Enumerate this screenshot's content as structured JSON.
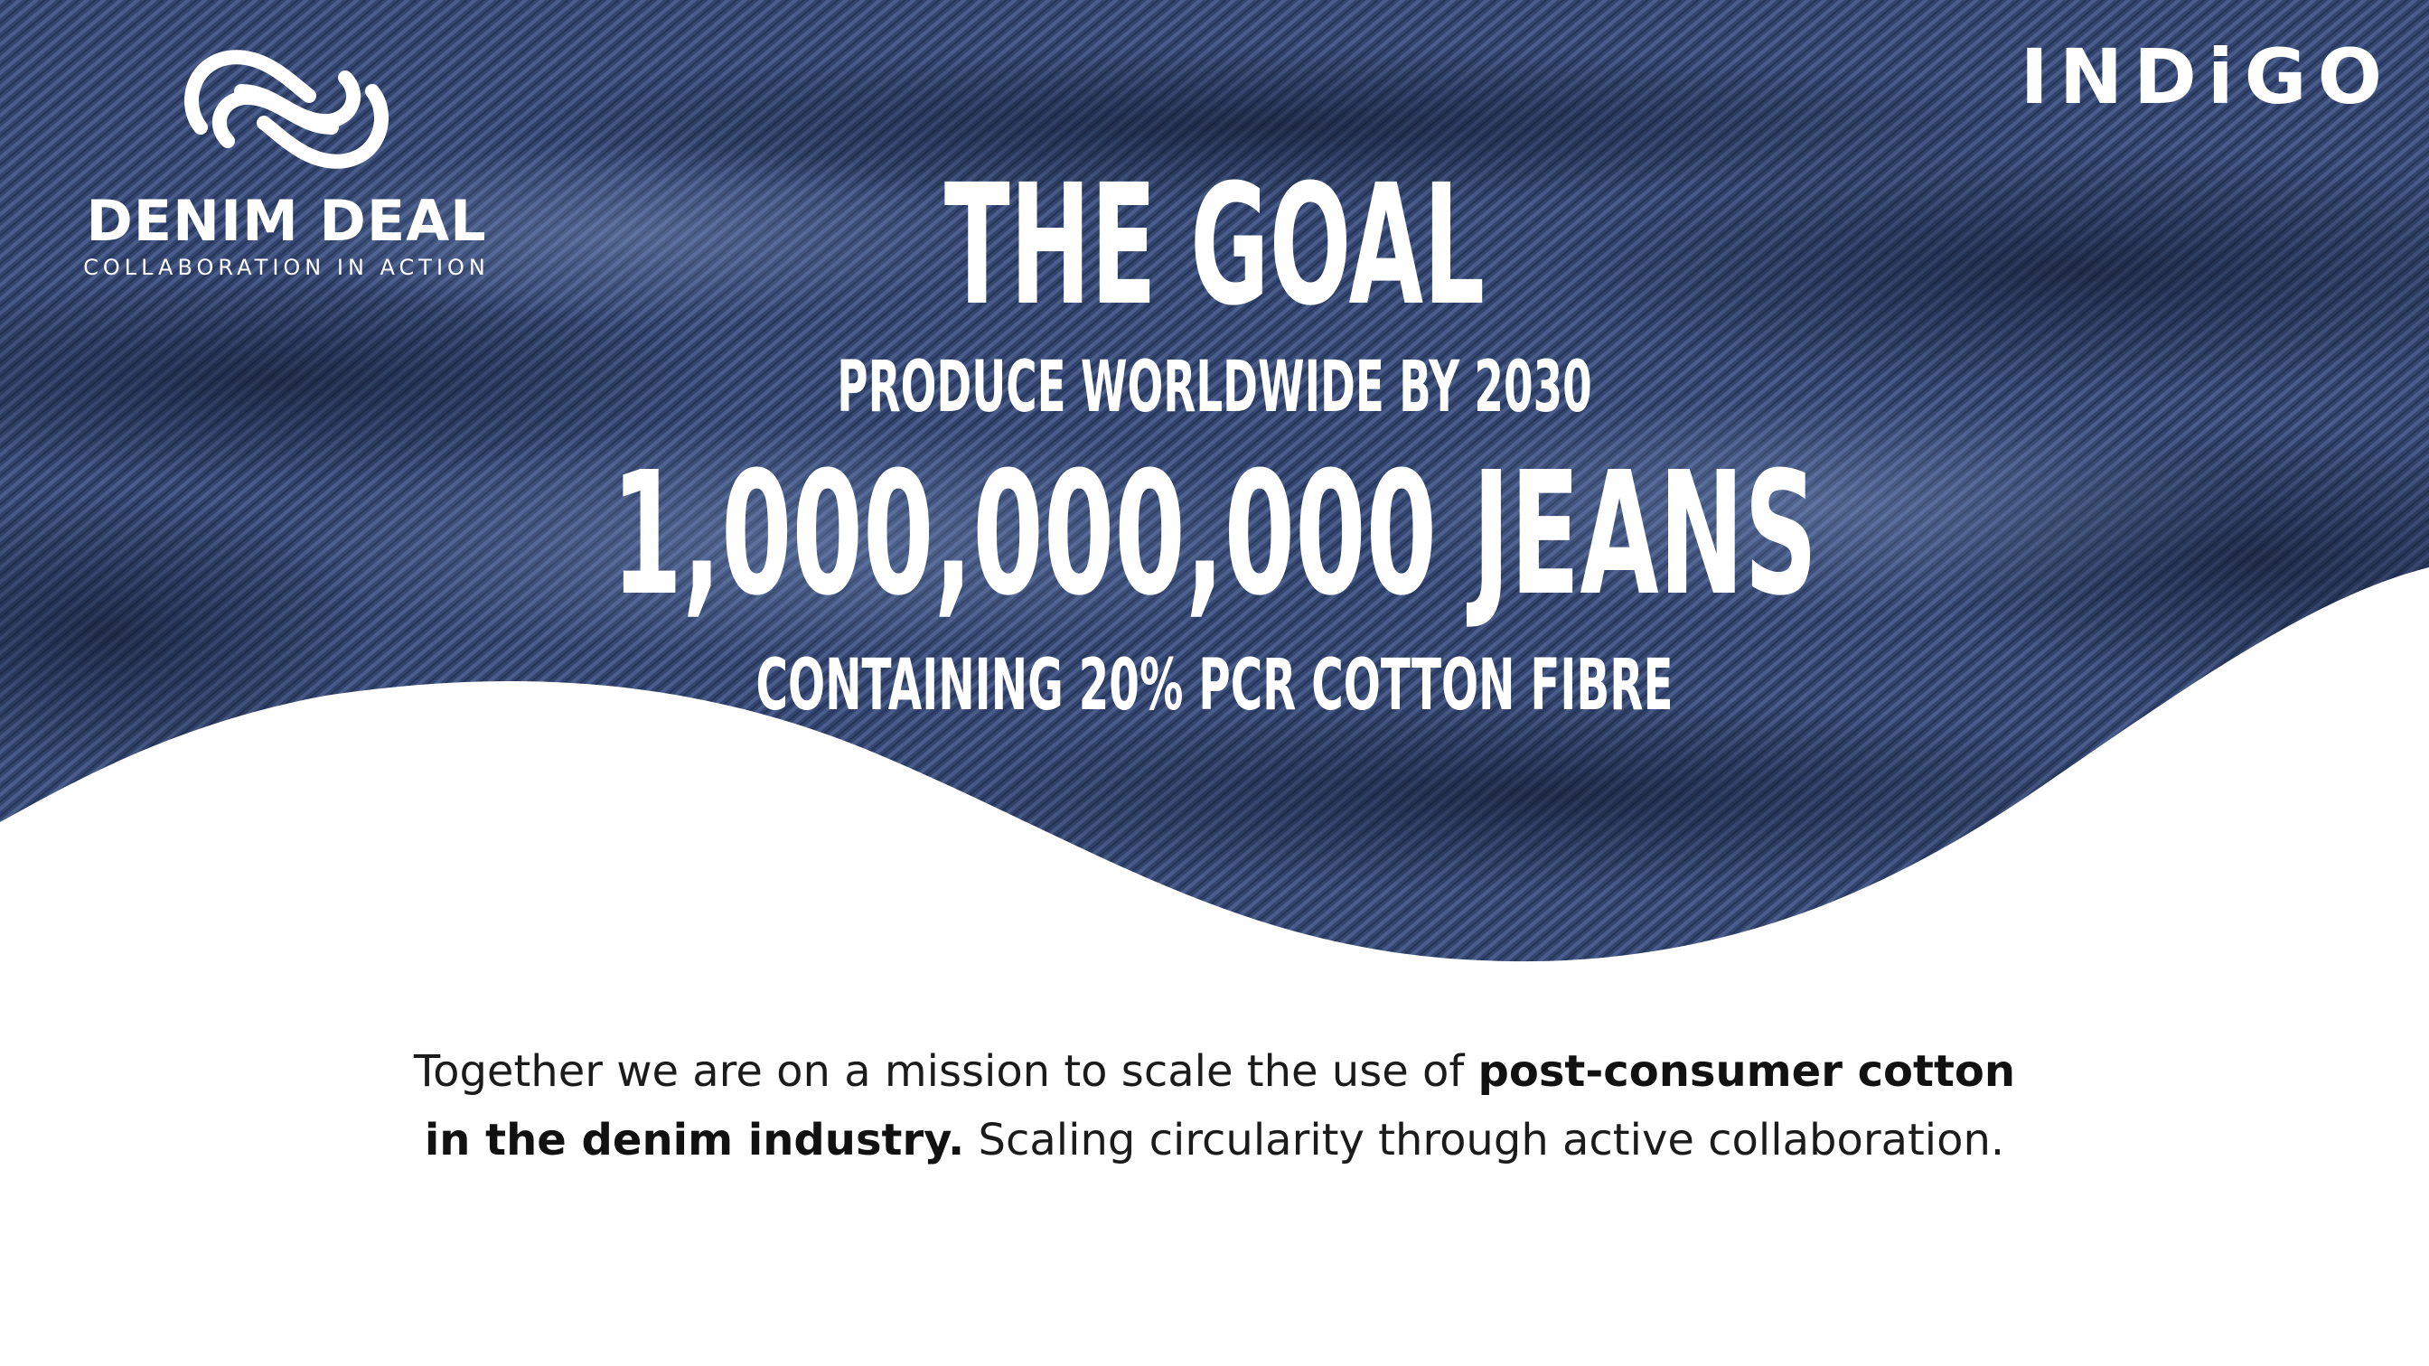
{
  "colors": {
    "denim_dark": "#1f2a45",
    "denim_mid": "#3a4d78",
    "denim_light": "#5b6f9c",
    "text_white": "#ffffff",
    "text_dark": "#111111"
  },
  "brand_left": {
    "name": "DENIM DEAL",
    "tagline": "COLLABORATION IN ACTION",
    "icon": "infinity-loop-icon"
  },
  "brand_right": {
    "name": "INDiGO"
  },
  "headline": {
    "title": "THE GOAL",
    "subtitle": "PRODUCE WORLDWIDE BY 2030",
    "number": "1,000,000,000 JEANS",
    "footnote": "CONTAINING 20% PCR COTTON FIBRE"
  },
  "mission": {
    "part1": "Together we are on a mission to scale the use of ",
    "bold1": "post-consumer cotton",
    "bold2": "in the denim industry.",
    "part2": " Scaling circularity through active collaboration."
  }
}
